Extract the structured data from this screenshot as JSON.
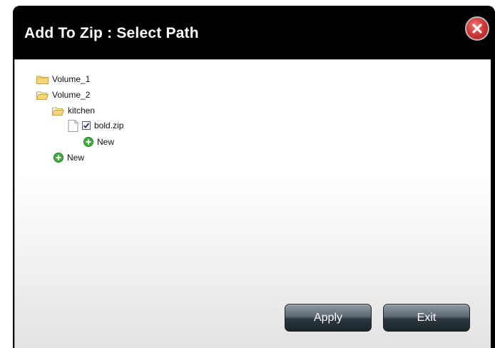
{
  "dialog": {
    "title": "Add To Zip : Select Path",
    "close_icon": "close-icon"
  },
  "tree": {
    "volume1": "Volume_1",
    "volume2": "Volume_2",
    "kitchen": "kitchen",
    "file": "bold.zip",
    "file_checked": true,
    "new_in_kitchen": "New",
    "new_in_volume2": "New"
  },
  "buttons": {
    "apply": "Apply",
    "exit": "Exit"
  },
  "colors": {
    "titlebar": "#000000",
    "folder": "#f2c75c",
    "plus": "#3fae3f",
    "close": "#d23a3a"
  }
}
